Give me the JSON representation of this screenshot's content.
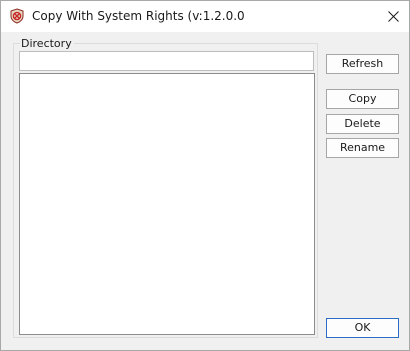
{
  "window": {
    "title": "Copy With System Rights (v:1.2.0.0",
    "close_icon": "close-icon",
    "app_icon": "app-shield-icon",
    "accent_color": "#2b6cc4"
  },
  "directory": {
    "group_label": "Directory",
    "path_value": "",
    "entries": []
  },
  "buttons": {
    "refresh": "Refresh",
    "copy": "Copy",
    "delete": "Delete",
    "rename": "Rename",
    "ok": "OK"
  }
}
